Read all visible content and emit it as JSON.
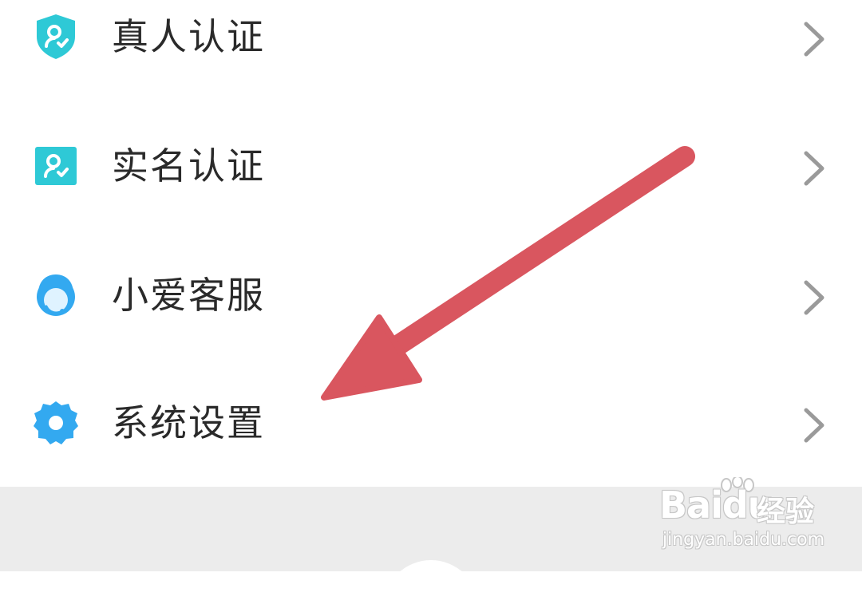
{
  "menu": {
    "items": [
      {
        "label": "真人认证",
        "icon": "shield-person-check-icon"
      },
      {
        "label": "实名认证",
        "icon": "id-card-check-icon"
      },
      {
        "label": "小爱客服",
        "icon": "customer-service-headset-icon"
      },
      {
        "label": "系统设置",
        "icon": "gear-icon"
      }
    ]
  },
  "annotation": {
    "type": "arrow",
    "color": "#d9565f",
    "points_to": "系统设置"
  },
  "watermark": {
    "brand": "Baidu",
    "product": "经验",
    "url": "jingyan.baidu.com"
  },
  "colors": {
    "icon_accent": "#2ec9d6",
    "icon_blue": "#33a9f0",
    "chevron": "#9a9a9a",
    "label": "#2a2a2a",
    "bottom_bar": "#ececec"
  }
}
